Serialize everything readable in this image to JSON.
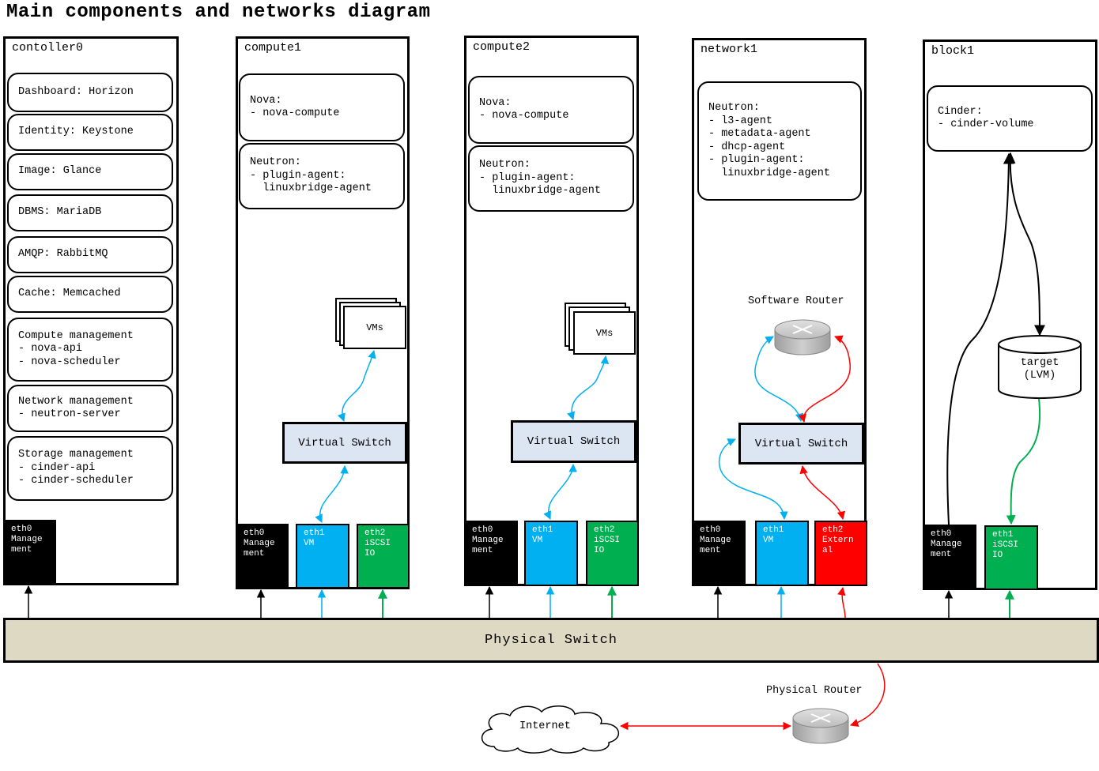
{
  "title": "Main components and networks diagram",
  "nodes": {
    "controller": {
      "name": "contoller0",
      "services": [
        "Dashboard: Horizon",
        "Identity: Keystone",
        "Image: Glance",
        "DBMS: MariaDB",
        "AMQP: RabbitMQ",
        "Cache: Memcached",
        "Compute management\n- nova-api\n- nova-scheduler",
        "Network management\n- neutron-server",
        "Storage management\n- cinder-api\n- cinder-scheduler"
      ],
      "eth0": "eth0\nManage\nment"
    },
    "compute1": {
      "name": "compute1",
      "nova": "Nova:\n- nova-compute",
      "neutron": "Neutron:\n- plugin-agent:\n  linuxbridge-agent",
      "vms": "VMs",
      "vswitch": "Virtual Switch",
      "eth0": "eth0\nManage\nment",
      "eth1": "eth1\nVM",
      "eth2": "eth2\niSCSI\nIO"
    },
    "compute2": {
      "name": "compute2",
      "nova": "Nova:\n- nova-compute",
      "neutron": "Neutron:\n- plugin-agent:\n  linuxbridge-agent",
      "vms": "VMs",
      "vswitch": "Virtual Switch",
      "eth0": "eth0\nManage\nment",
      "eth1": "eth1\nVM",
      "eth2": "eth2\niSCSI\nIO"
    },
    "network1": {
      "name": "network1",
      "neutron": "Neutron:\n- l3-agent\n- metadata-agent\n- dhcp-agent\n- plugin-agent:\n  linuxbridge-agent",
      "router_label": "Software Router",
      "vswitch": "Virtual Switch",
      "eth0": "eth0\nManage\nment",
      "eth1": "eth1\nVM",
      "eth2": "eth2\nExtern\nal"
    },
    "block1": {
      "name": "block1",
      "cinder": "Cinder:\n- cinder-volume",
      "target": "target\n(LVM)",
      "eth0": "eth0\nManage\nment",
      "eth1": "eth1\niSCSI\nIO"
    }
  },
  "physical_switch": "Physical Switch",
  "physical_router": "Physical Router",
  "internet": "Internet",
  "colors": {
    "vm_net": "#00b0f0",
    "iscsi_net": "#00b050",
    "external_net": "#ff0000",
    "mgmt_net": "#000000",
    "switch_fill": "#dce6f2",
    "phys_switch_fill": "#ddd9c3"
  },
  "icons": [
    "router-icon",
    "cloud-icon"
  ]
}
